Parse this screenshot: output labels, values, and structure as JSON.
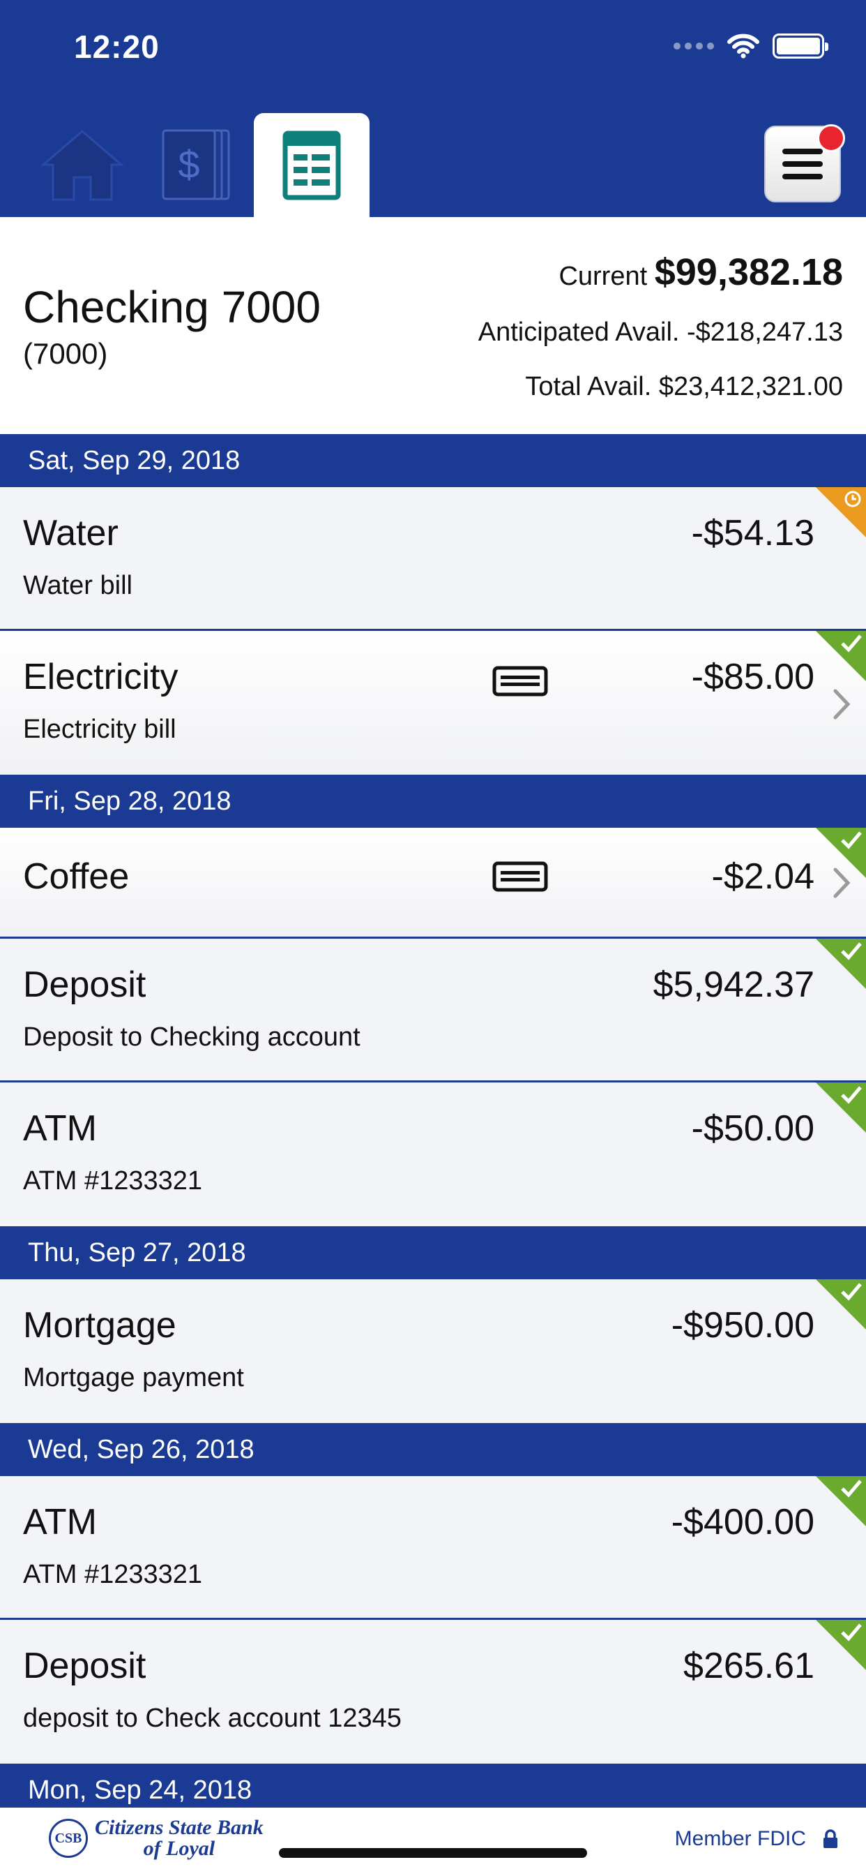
{
  "status_bar": {
    "time": "12:20"
  },
  "tabs": [
    {
      "name": "home",
      "icon": "home-icon"
    },
    {
      "name": "accounts",
      "icon": "dollar-stack-icon"
    },
    {
      "name": "activity",
      "icon": "ledger-icon",
      "selected": true
    }
  ],
  "account": {
    "name": "Checking 7000",
    "number": "(7000)",
    "current_label": "Current",
    "current_amount": "$99,382.18",
    "anticipated_label": "Anticipated Avail.",
    "anticipated_amount": "-$218,247.13",
    "total_label": "Total Avail.",
    "total_amount": "$23,412,321.00"
  },
  "groups": [
    {
      "date": "Sat, Sep 29, 2018",
      "items": [
        {
          "title": "Water",
          "desc": "Water bill",
          "amount": "-$54.13",
          "status": "pending"
        },
        {
          "title": "Electricity",
          "desc": "Electricity bill",
          "amount": "-$85.00",
          "status": "cleared"
        }
      ]
    },
    {
      "date": "Fri, Sep 28, 2018",
      "items": [
        {
          "title": "Coffee",
          "amount": "-$2.04",
          "status": "cleared"
        },
        {
          "title": "Deposit",
          "desc": "Deposit to Checking account",
          "amount": "$5,942.37",
          "status": "cleared"
        },
        {
          "title": "ATM",
          "desc": "ATM #1233321",
          "amount": "-$50.00",
          "status": "cleared"
        }
      ]
    },
    {
      "date": "Thu, Sep 27, 2018",
      "items": [
        {
          "title": "Mortgage",
          "desc": "Mortgage payment",
          "amount": "-$950.00",
          "status": "cleared"
        }
      ]
    },
    {
      "date": "Wed, Sep 26, 2018",
      "items": [
        {
          "title": "ATM",
          "desc": "ATM #1233321",
          "amount": "-$400.00",
          "status": "cleared"
        },
        {
          "title": "Deposit",
          "desc": "deposit to Check account 12345",
          "amount": "$265.61",
          "status": "cleared"
        }
      ]
    },
    {
      "date": "Mon, Sep 24, 2018",
      "items": []
    }
  ],
  "footer": {
    "bank_initials": "CSB",
    "bank_name_line1": "Citizens State Bank",
    "bank_name_line2": "of Loyal",
    "member_text": "Member FDIC"
  },
  "colors": {
    "brand_blue": "#1a3a94",
    "cleared_green": "#6aaa2e",
    "pending_orange": "#e99a1f",
    "badge_red": "#e8242f"
  }
}
